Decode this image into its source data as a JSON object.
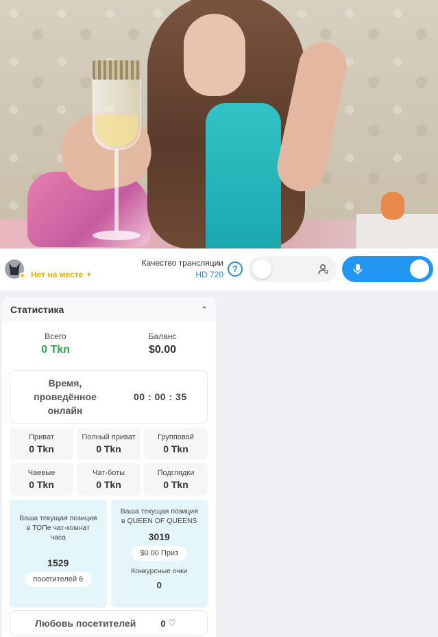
{
  "controls": {
    "status": "Нет на месте",
    "quality_title": "Качество трансляции",
    "quality_value": "HD 720",
    "help_symbol": "?"
  },
  "stats": {
    "title": "Статистика",
    "total_label": "Всего",
    "total_value": "0 Tkn",
    "balance_label": "Баланс",
    "balance_value": "$0.00",
    "time_label_lines": [
      "Время,",
      "проведённое",
      "онлайн"
    ],
    "time_value": "00 : 00 : 35",
    "cells": [
      {
        "label": "Приват",
        "value": "0 Tkn"
      },
      {
        "label": "Полный приват",
        "value": "0 Tkn"
      },
      {
        "label": "Групповой",
        "value": "0 Tkn"
      },
      {
        "label": "Чаевые",
        "value": "0 Tkn"
      },
      {
        "label": "Чат-боты",
        "value": "0 Tkn"
      },
      {
        "label": "Подглядки",
        "value": "0 Tkn"
      }
    ],
    "top_chat": {
      "text": "Ваша текущая позиция в ТОПе чат-комнат часа",
      "number": "1529",
      "pill": "посетителей 6"
    },
    "top_queen": {
      "text": "Ваша текущая позиция в QUEEN OF QUEENS",
      "number": "3019",
      "pill": "$0.00 Приз",
      "points_label": "Конкурсные очки",
      "points_value": "0"
    },
    "love_label": "Любовь посетителей",
    "love_value": "0"
  },
  "colors": {
    "accent_blue": "#2196f3",
    "status_yellow": "#e6ac00",
    "tokens_green": "#2eaa4b"
  }
}
